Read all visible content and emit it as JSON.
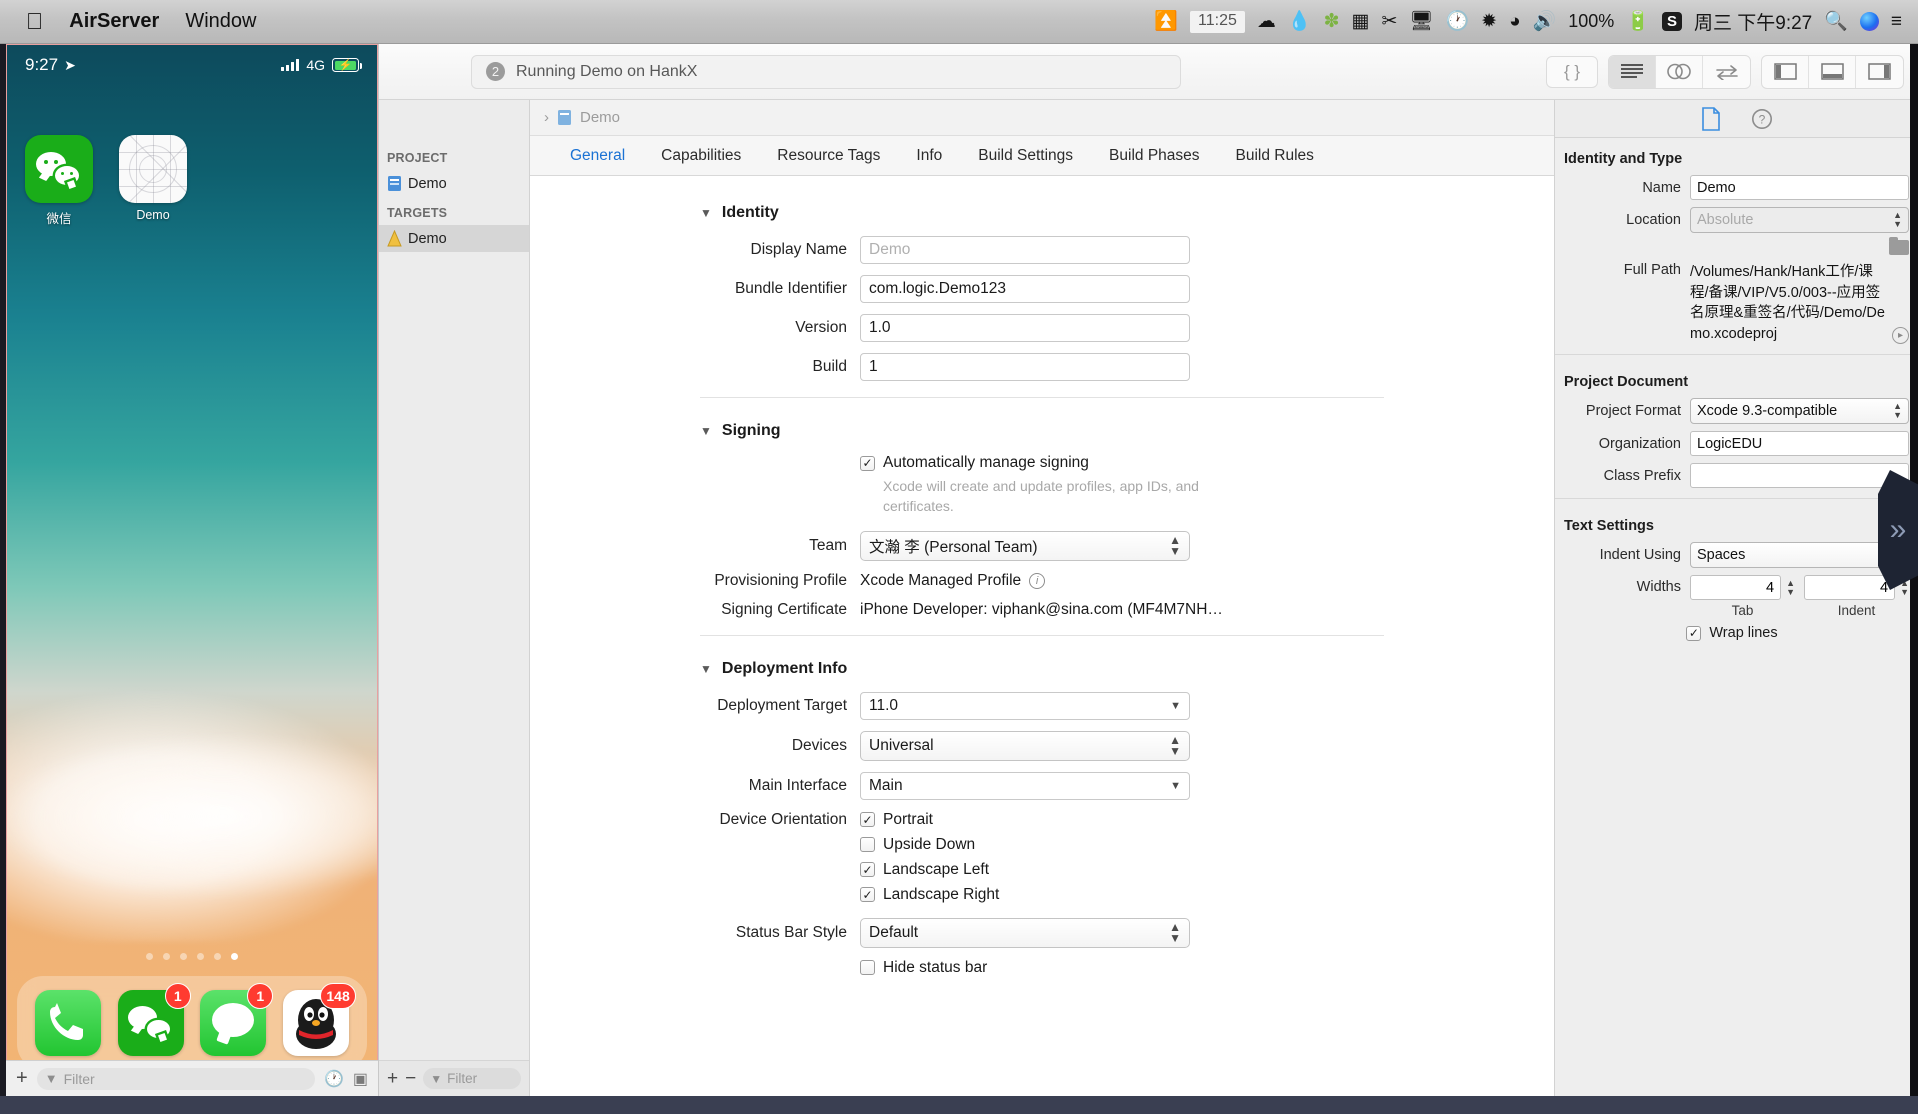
{
  "menubar": {
    "apple": "",
    "app_name": "AirServer",
    "window_menu": "Window",
    "airplay_label": "11:25",
    "battery_percent": "100%",
    "datetime": "周三 下午9:27",
    "sogou": "S",
    "icons": [
      "airplay-icon",
      "cloud-icon",
      "droplet-icon",
      "leaf-icon",
      "grid-icon",
      "scissors-icon",
      "display-icon",
      "clock-icon",
      "bluetooth-icon",
      "wifi-icon",
      "volume-icon",
      "battery-icon",
      "sogou-input-icon",
      "spotlight-search-icon",
      "siri-icon",
      "notification-center-icon"
    ]
  },
  "ios": {
    "status": {
      "time": "9:27",
      "location_icon": "location-arrow-icon",
      "carrier": "4G",
      "battery_level": ""
    },
    "apps": [
      {
        "name": "微信",
        "icon": "wechat-icon"
      },
      {
        "name": "Demo",
        "icon": "demo-app-icon"
      }
    ],
    "page_dots": 6,
    "active_dot": 6,
    "dock": [
      {
        "name": "Phone",
        "icon": "phone-icon",
        "badge": ""
      },
      {
        "name": "WeChat",
        "icon": "wechat-icon",
        "badge": "1"
      },
      {
        "name": "Messages",
        "icon": "messages-icon",
        "badge": "1"
      },
      {
        "name": "QQ",
        "icon": "qq-icon",
        "badge": "148"
      }
    ],
    "filter": {
      "placeholder": "Filter",
      "add_label": "+"
    }
  },
  "xcode": {
    "toolbar": {
      "status_count": "2",
      "status_text": "Running Demo on HankX",
      "library_icon": "braces-icon",
      "editor_buttons": [
        "standard-editor-icon",
        "assistant-editor-icon",
        "version-editor-icon"
      ],
      "panel_buttons": [
        "navigator-toggle-icon",
        "debug-toggle-icon",
        "inspector-toggle-icon"
      ]
    },
    "jumpbar": {
      "chevron": "›",
      "item": "Demo"
    },
    "navigator": {
      "project_header": "PROJECT",
      "targets_header": "TARGETS",
      "project_item": "Demo",
      "target_item": "Demo",
      "add_label": "+",
      "remove_label": "−",
      "filter_placeholder": "Filter"
    },
    "tabs": [
      {
        "label": "General",
        "active": true
      },
      {
        "label": "Capabilities",
        "active": false
      },
      {
        "label": "Resource Tags",
        "active": false
      },
      {
        "label": "Info",
        "active": false
      },
      {
        "label": "Build Settings",
        "active": false
      },
      {
        "label": "Build Phases",
        "active": false
      },
      {
        "label": "Build Rules",
        "active": false
      }
    ],
    "general": {
      "identity": {
        "title": "Identity",
        "display_name_label": "Display Name",
        "display_name_placeholder": "Demo",
        "bundle_id_label": "Bundle Identifier",
        "bundle_id_value": "com.logic.Demo123",
        "version_label": "Version",
        "version_value": "1.0",
        "build_label": "Build",
        "build_value": "1"
      },
      "signing": {
        "title": "Signing",
        "auto_manage_label": "Automatically manage signing",
        "auto_manage_checked": true,
        "auto_manage_hint": "Xcode will create and update profiles, app IDs, and certificates.",
        "team_label": "Team",
        "team_value": "文瀚 李 (Personal Team)",
        "profile_label": "Provisioning Profile",
        "profile_value": "Xcode Managed Profile",
        "certificate_label": "Signing Certificate",
        "certificate_value": "iPhone Developer: viphank@sina.com (MF4M7NH…"
      },
      "deployment": {
        "title": "Deployment Info",
        "target_label": "Deployment Target",
        "target_value": "11.0",
        "devices_label": "Devices",
        "devices_value": "Universal",
        "main_interface_label": "Main Interface",
        "main_interface_value": "Main",
        "orientation_label": "Device Orientation",
        "orientations": [
          {
            "label": "Portrait",
            "checked": true
          },
          {
            "label": "Upside Down",
            "checked": false
          },
          {
            "label": "Landscape Left",
            "checked": true
          },
          {
            "label": "Landscape Right",
            "checked": true
          }
        ],
        "status_bar_label": "Status Bar Style",
        "status_bar_value": "Default",
        "hide_status_label": "Hide status bar",
        "hide_status_checked": false
      }
    },
    "inspector": {
      "tabs": [
        "file-inspector-icon",
        "quick-help-icon"
      ],
      "identity": {
        "title": "Identity and Type",
        "name_label": "Name",
        "name_value": "Demo",
        "location_label": "Location",
        "location_value": "Absolute",
        "full_path_label": "Full Path",
        "full_path_value": "/Volumes/Hank/Hank工作/课程/备课/VIP/V5.0/003--应用签名原理&重签名/代码/Demo/Demo.xcodeproj"
      },
      "project_doc": {
        "title": "Project Document",
        "format_label": "Project Format",
        "format_value": "Xcode 9.3-compatible",
        "org_label": "Organization",
        "org_value": "LogicEDU",
        "prefix_label": "Class Prefix",
        "prefix_value": ""
      },
      "text_settings": {
        "title": "Text Settings",
        "indent_label": "Indent Using",
        "indent_value": "Spaces",
        "widths_label": "Widths",
        "tab_width": "4",
        "indent_width": "4",
        "tab_caption": "Tab",
        "indent_caption": "Indent",
        "wrap_label": "Wrap lines",
        "wrap_checked": true
      }
    }
  },
  "overlay": {
    "chevron": "»"
  },
  "colors": {
    "accent": "#1a72d4",
    "badge_red": "#ff3b30",
    "ios_green": "#1AAD19"
  }
}
